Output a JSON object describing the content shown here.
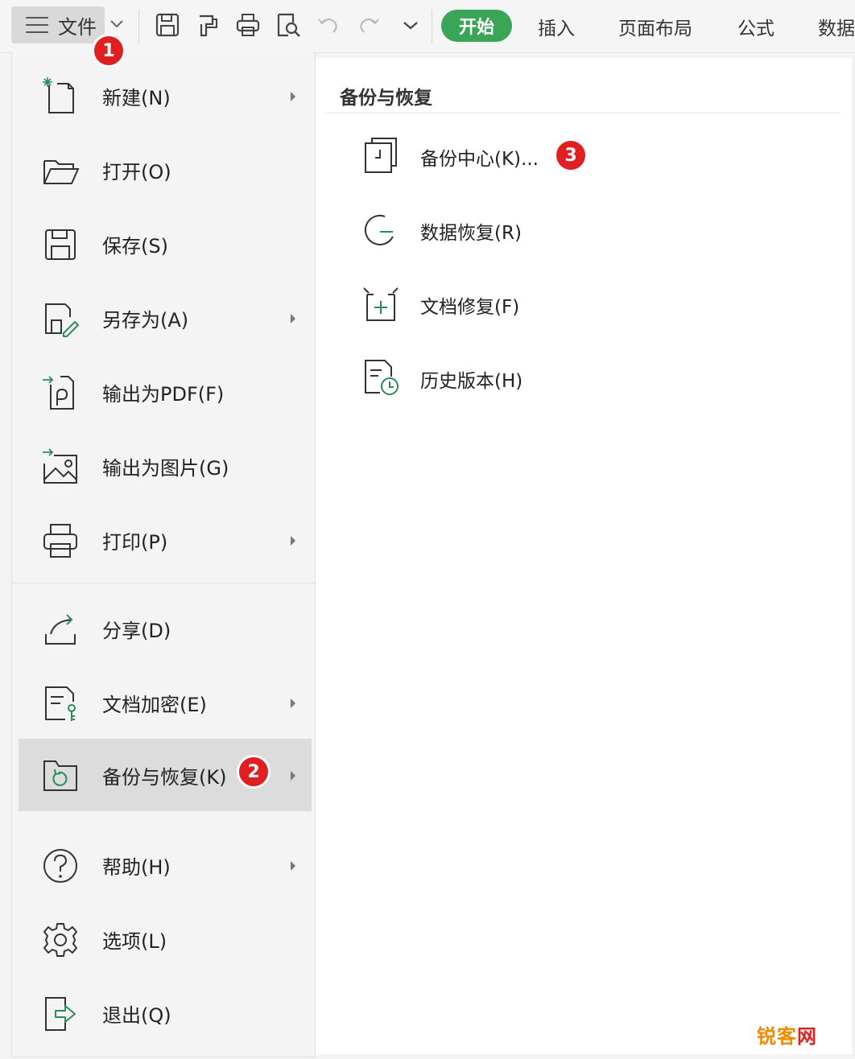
{
  "toolbar": {
    "file_label": "文件",
    "tabs": [
      "开始",
      "插入",
      "页面布局",
      "公式",
      "数据"
    ]
  },
  "badges": [
    "1",
    "2",
    "3"
  ],
  "menu": {
    "items": [
      {
        "label": "新建(N)",
        "icon": "new-file-icon"
      },
      {
        "label": "打开(O)",
        "icon": "folder-open-icon"
      },
      {
        "label": "保存(S)",
        "icon": "save-icon"
      },
      {
        "label": "另存为(A)",
        "icon": "save-as-icon"
      },
      {
        "label": "输出为PDF(F)",
        "icon": "export-pdf-icon"
      },
      {
        "label": "输出为图片(G)",
        "icon": "export-image-icon"
      },
      {
        "label": "打印(P)",
        "icon": "print-icon"
      },
      {
        "label": "分享(D)",
        "icon": "share-icon"
      },
      {
        "label": "文档加密(E)",
        "icon": "encrypt-icon"
      },
      {
        "label": "备份与恢复(K)",
        "icon": "backup-folder-icon"
      },
      {
        "label": "帮助(H)",
        "icon": "help-icon"
      },
      {
        "label": "选项(L)",
        "icon": "gear-icon"
      },
      {
        "label": "退出(Q)",
        "icon": "exit-icon"
      }
    ]
  },
  "submenu": {
    "title": "备份与恢复",
    "items": [
      {
        "label": "备份中心(K)...",
        "icon": "backup-center-icon"
      },
      {
        "label": "数据恢复(R)",
        "icon": "data-recovery-icon"
      },
      {
        "label": "文档修复(F)",
        "icon": "doc-repair-icon"
      },
      {
        "label": "历史版本(H)",
        "icon": "history-version-icon"
      }
    ]
  },
  "watermark": {
    "part1": "锐客",
    "part2": "网"
  },
  "colors": {
    "accent": "#3aa457",
    "badge": "#e02020",
    "icon_accent": "#2e8b57"
  }
}
